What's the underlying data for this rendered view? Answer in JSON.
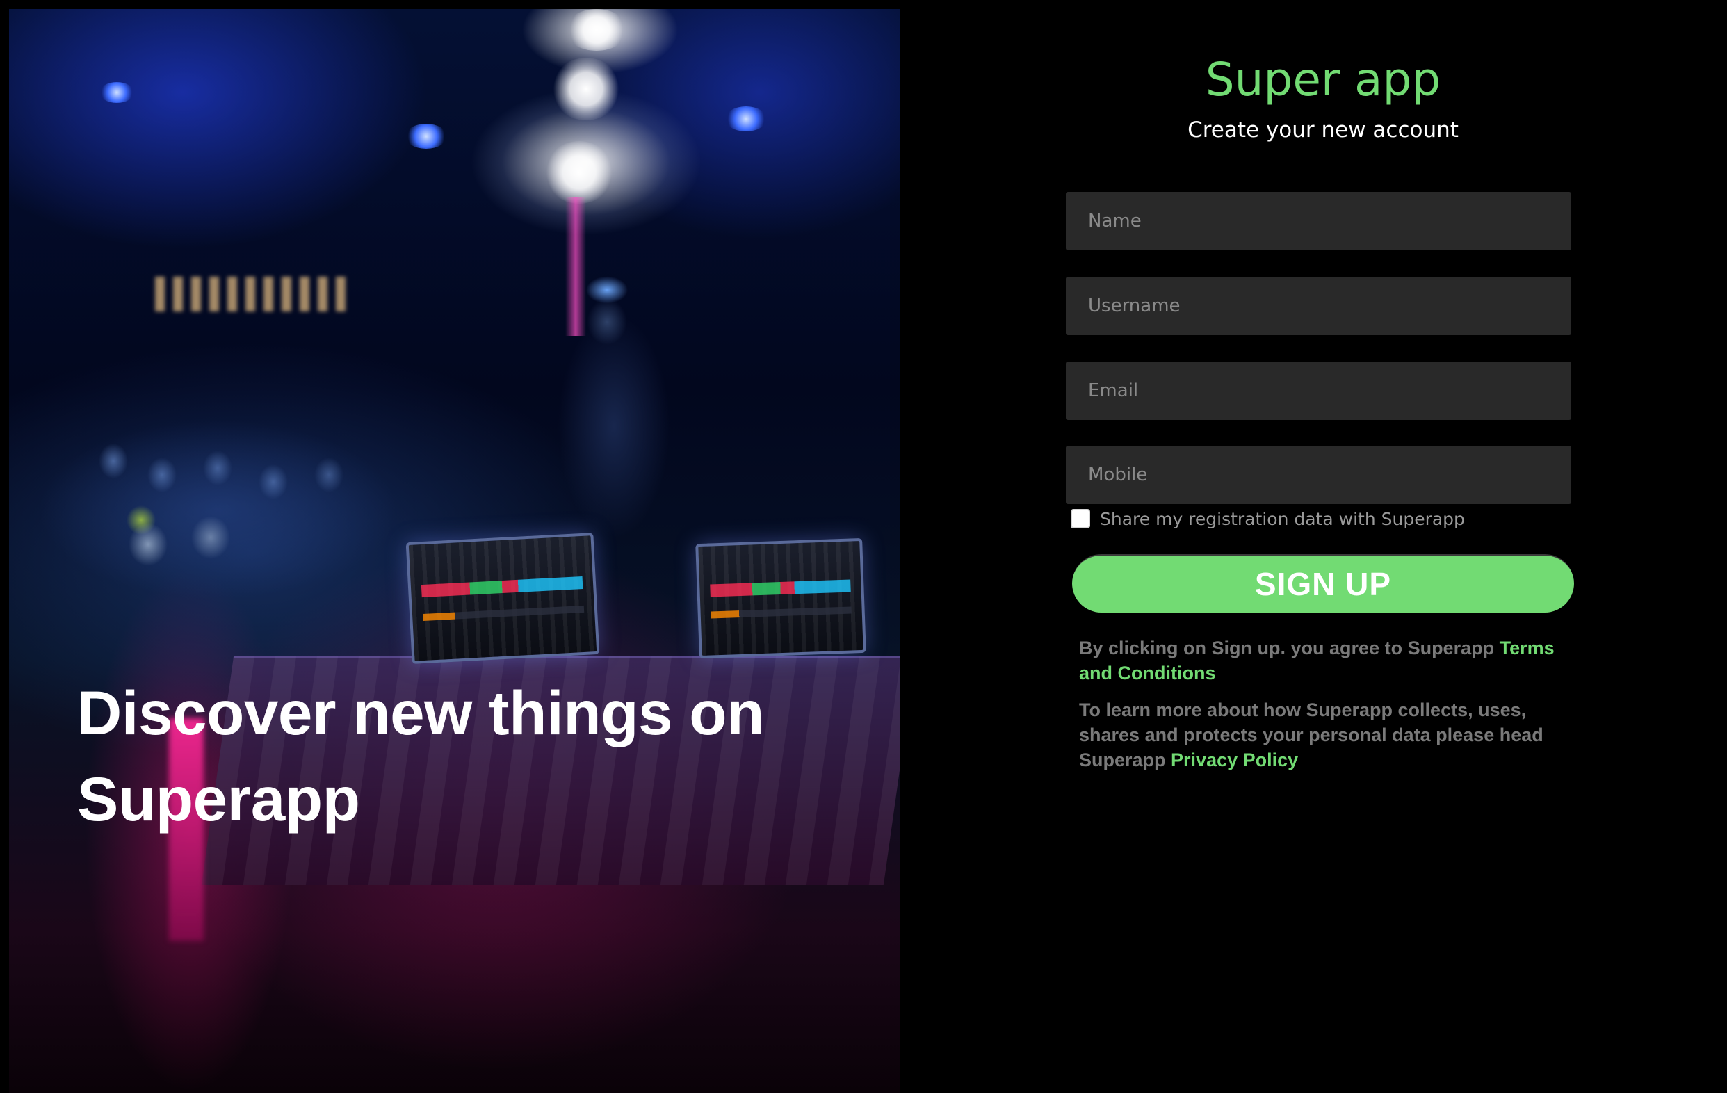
{
  "hero": {
    "title_line1": "Discover new things on",
    "title_line2": "Superapp"
  },
  "brand": {
    "name": "Super app",
    "subtitle": "Create your new account"
  },
  "form": {
    "name_placeholder": "Name",
    "username_placeholder": "Username",
    "email_placeholder": "Email",
    "mobile_placeholder": "Mobile",
    "share_label": "Share my registration data with Superapp",
    "share_checked": false,
    "signup_label": "SIGN UP"
  },
  "legal": {
    "terms_prefix": "By clicking on Sign up. you agree to Superapp ",
    "terms_link": "Terms and Conditions",
    "privacy_prefix": "To learn more about how Superapp collects, uses, shares and protects your personal data please head Superapp ",
    "privacy_link": "Privacy Policy"
  },
  "colors": {
    "accent": "#72db73",
    "background": "#000000",
    "field_bg": "#292929",
    "muted_text": "#7a7a7a"
  }
}
